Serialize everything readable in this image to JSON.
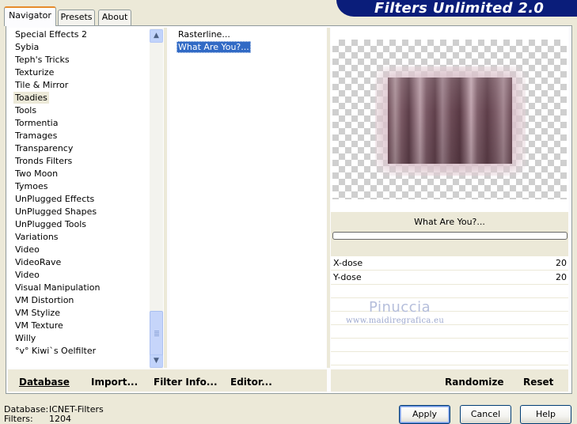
{
  "tabs": [
    {
      "label": "Navigator",
      "active": true
    },
    {
      "label": "Presets",
      "active": false
    },
    {
      "label": "About",
      "active": false
    }
  ],
  "app_title": "Filters Unlimited 2.0",
  "categories": [
    "Special Effects 2",
    "Sybia",
    "Teph's Tricks",
    "Texturize",
    "Tile & Mirror",
    "Toadies",
    "Tools",
    "Tormentia",
    "Tramages",
    "Transparency",
    "Tronds Filters",
    "Two Moon",
    "Tymoes",
    "UnPlugged Effects",
    "UnPlugged Shapes",
    "UnPlugged Tools",
    "Variations",
    "Video",
    "VideoRave",
    "Video",
    "Visual Manipulation",
    "VM Distortion",
    "VM Stylize",
    "VM Texture",
    "Willy",
    "°v° Kiwi`s Oelfilter"
  ],
  "selected_category": "Toadies",
  "filters": [
    "Rasterline...",
    "What Are You?..."
  ],
  "selected_filter": "What Are You?...",
  "preview": {
    "filter_name": "What Are You?...",
    "progress": 0
  },
  "params": [
    {
      "label": "X-dose",
      "value": "20"
    },
    {
      "label": "Y-dose",
      "value": "20"
    }
  ],
  "watermark": {
    "name": "Pinuccia",
    "url": "www.maidiregrafica.eu"
  },
  "bottom_buttons": {
    "database": "Database",
    "import": "Import...",
    "filter_info": "Filter Info...",
    "editor": "Editor...",
    "randomize": "Randomize",
    "reset": "Reset"
  },
  "status": {
    "database_label": "Database:",
    "database_value": "ICNET-Filters",
    "filters_label": "Filters:",
    "filters_value": "1204"
  },
  "dialog_buttons": {
    "apply": "Apply",
    "cancel": "Cancel",
    "help": "Help"
  },
  "colors": {
    "selection": "#316ac5",
    "banner": "#0a1d7a",
    "dialog_bg": "#ece9d8"
  }
}
